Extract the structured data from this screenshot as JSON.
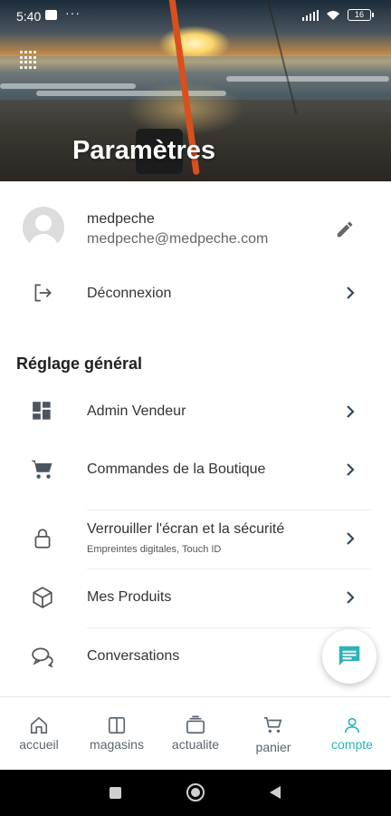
{
  "statusbar": {
    "time": "5:40",
    "dots": "···",
    "battery": "16"
  },
  "header": {
    "title": "Paramètres"
  },
  "profile": {
    "name": "medpeche",
    "email": "medpeche@medpeche.com"
  },
  "logout": {
    "label": "Déconnexion"
  },
  "section": {
    "title": "Réglage général"
  },
  "menu": [
    {
      "label": "Admin Vendeur",
      "icon": "dashboard-icon"
    },
    {
      "label": "Commandes de la Boutique",
      "icon": "cart-icon"
    },
    {
      "label": "Verrouiller l'écran et la sécurité",
      "sub": "Empreintes digitales, Touch ID",
      "icon": "lock-icon"
    },
    {
      "label": "Mes Produits",
      "icon": "box-icon"
    },
    {
      "label": "Conversations",
      "icon": "chat-icon"
    }
  ],
  "bottomnav": [
    {
      "label": "accueil",
      "icon": "home-icon"
    },
    {
      "label": "magasins",
      "icon": "store-icon"
    },
    {
      "label": "actualite",
      "icon": "news-icon"
    },
    {
      "label": "panier",
      "icon": "cart-icon"
    },
    {
      "label": "compte",
      "icon": "user-icon",
      "active": true
    }
  ],
  "colors": {
    "accent": "#2ab3b8",
    "text": "#333333"
  }
}
